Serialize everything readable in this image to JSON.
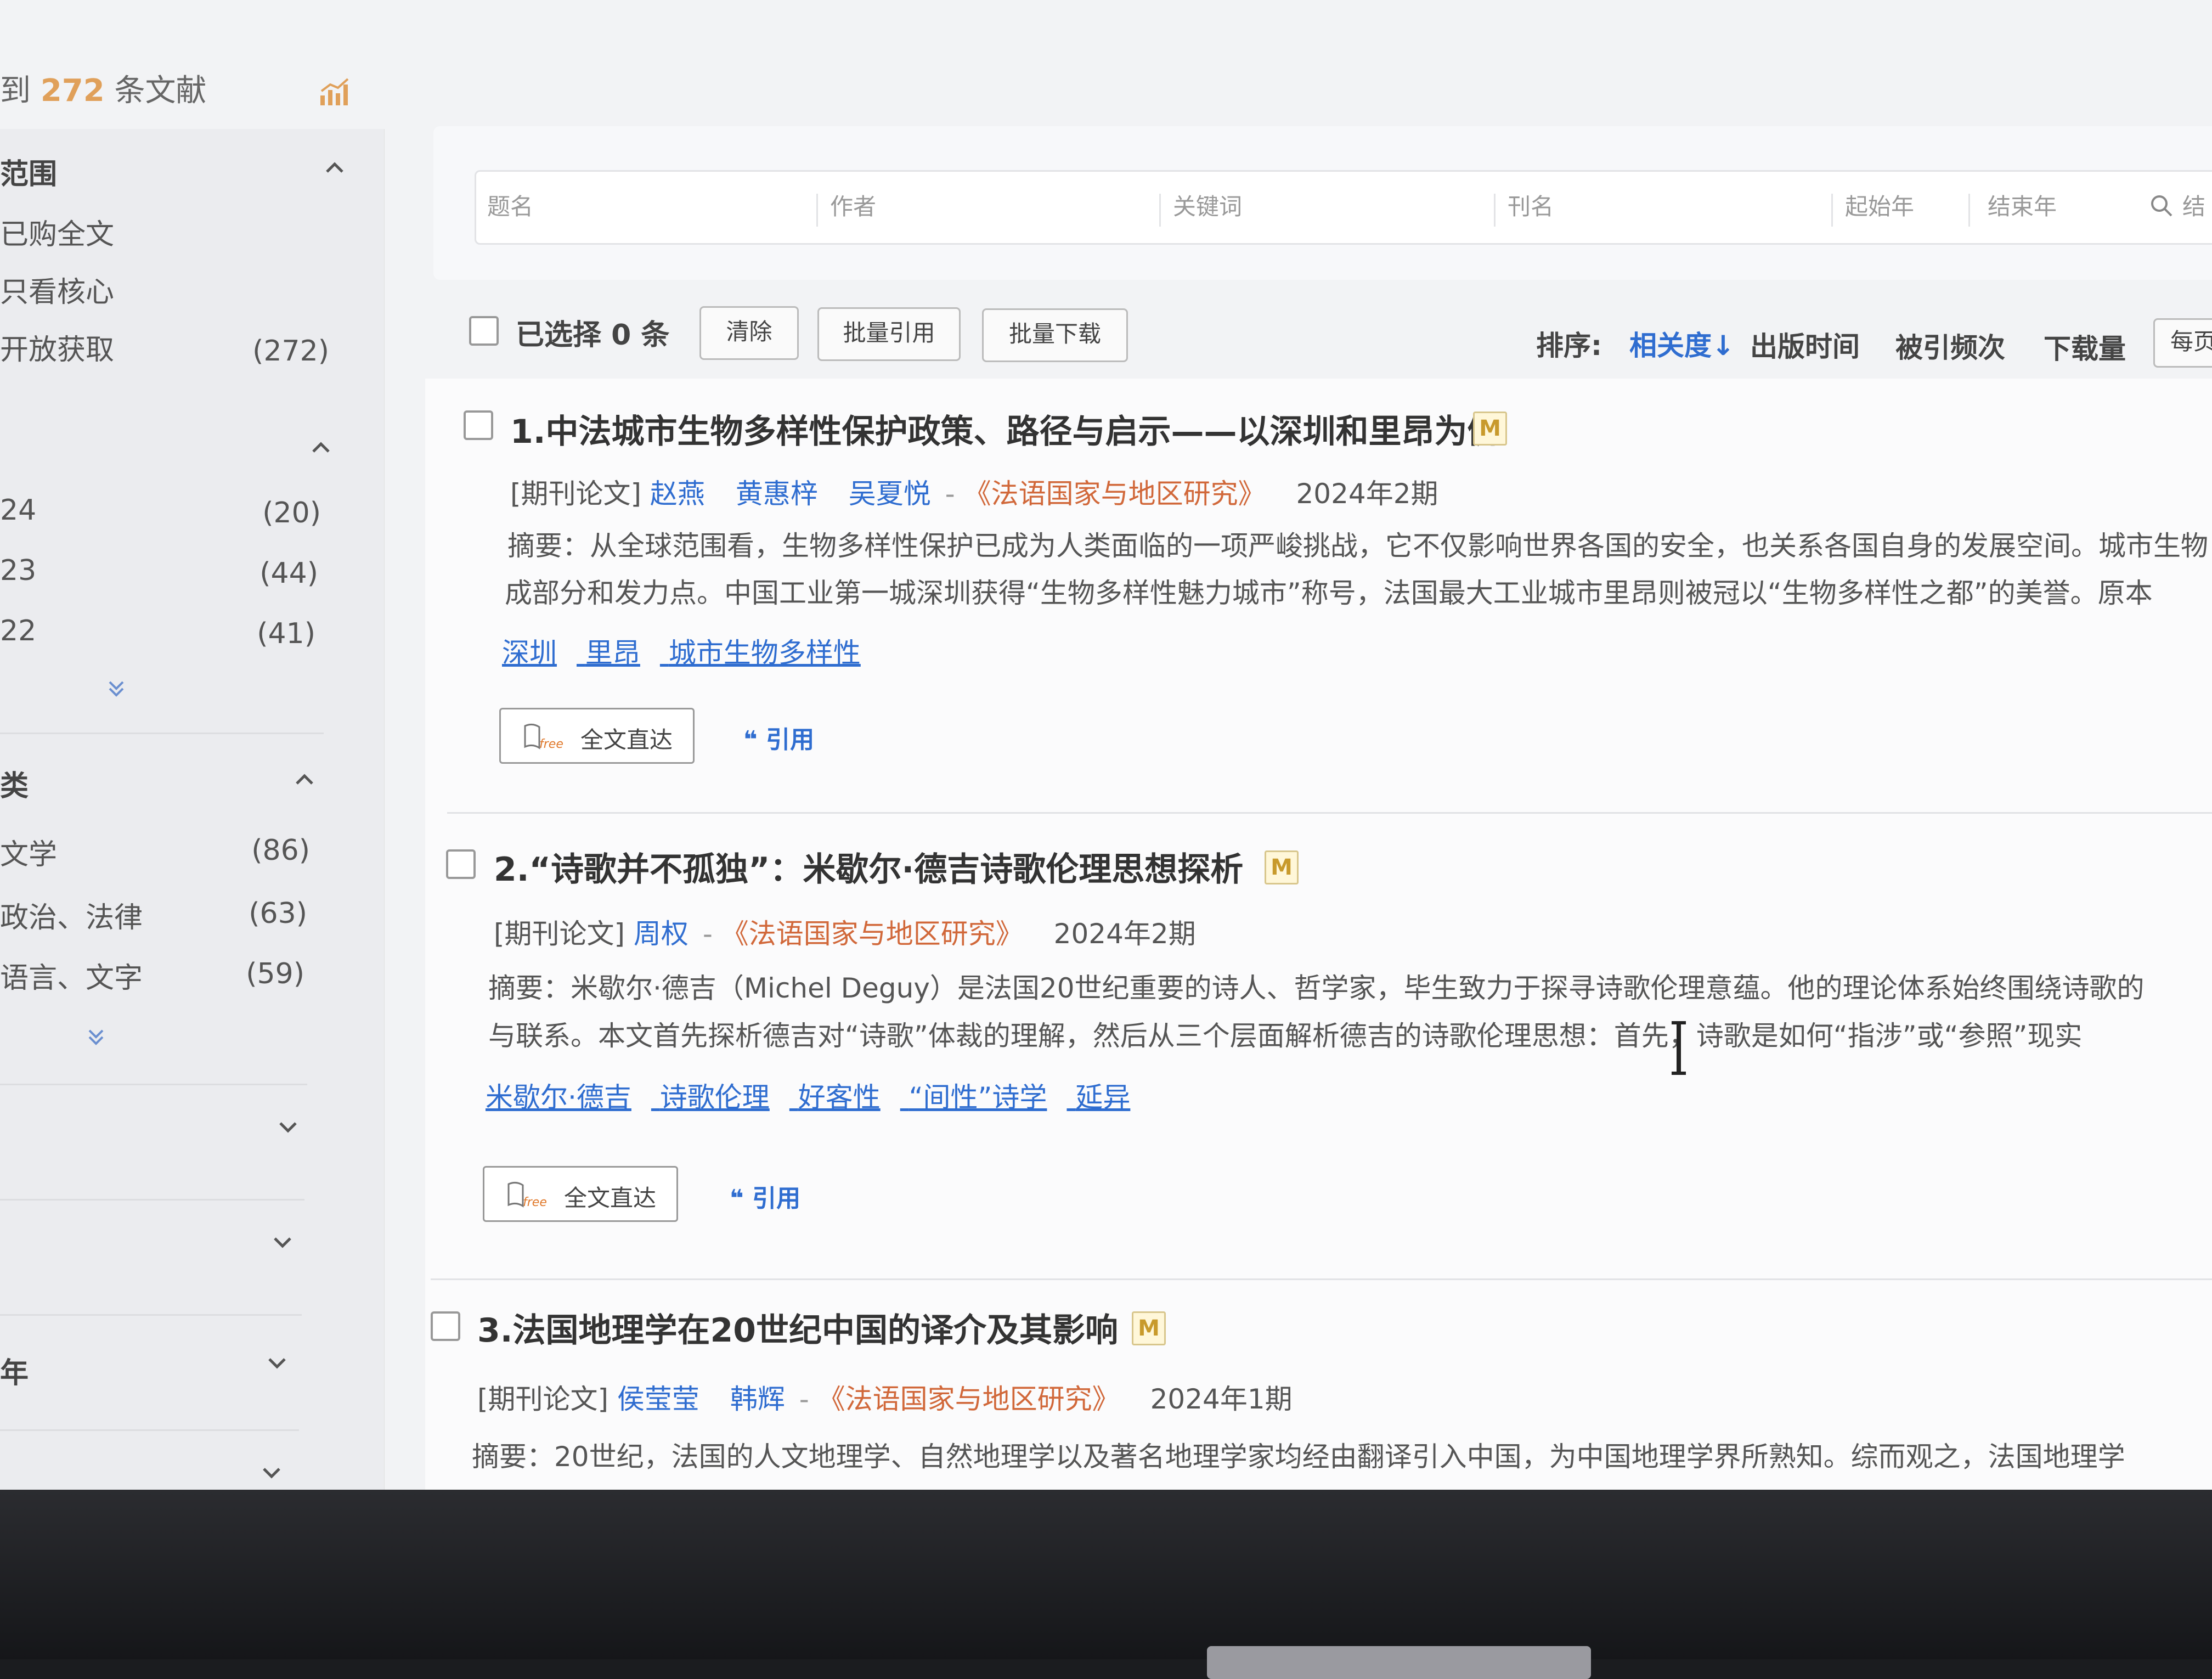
{
  "header": {
    "count_prefix": "到",
    "count": "272",
    "count_suffix": "条文献"
  },
  "sidebar": {
    "range": {
      "title": "范围",
      "items": [
        {
          "label": "已购全文",
          "count": ""
        },
        {
          "label": "只看核心",
          "count": ""
        },
        {
          "label": "开放获取",
          "count": "(272)"
        }
      ]
    },
    "year": {
      "title": "",
      "items": [
        {
          "label": "24",
          "count": "(20)"
        },
        {
          "label": "23",
          "count": "(44)"
        },
        {
          "label": "22",
          "count": "(41)"
        }
      ]
    },
    "subject": {
      "title": "类",
      "items": [
        {
          "label": "文学",
          "count": "(86)"
        },
        {
          "label": "政治、法律",
          "count": "(63)"
        },
        {
          "label": "语言、文字",
          "count": "(59)"
        }
      ]
    },
    "collapsed_section_label": "年"
  },
  "search": {
    "title_placeholder": "题名",
    "author_placeholder": "作者",
    "keyword_placeholder": "关键词",
    "journal_placeholder": "刊名",
    "start_year_placeholder": "起始年",
    "end_year_placeholder": "结束年",
    "search_in_results": "结"
  },
  "toolbar": {
    "selected": "已选择 0 条",
    "clear": "清除",
    "batch_cite": "批量引用",
    "batch_download": "批量下载",
    "sort_label": "排序:",
    "sort_relevance": "相关度↓",
    "sort_date": "出版时间",
    "sort_citations": "被引频次",
    "sort_downloads": "下载量",
    "per_page": "每页"
  },
  "results": [
    {
      "title": "1.中法城市生物多样性保护政策、路径与启示——以深圳和里昂为例",
      "badge": "M",
      "type": "[期刊论文]",
      "authors": [
        "赵燕",
        "黄惠梓",
        "吴夏悦"
      ],
      "journal": "《法语国家与地区研究》",
      "issue": "2024年2期",
      "abstract_line1": "摘要：从全球范围看，生物多样性保护已成为人类面临的一项严峻挑战，它不仅影响世界各国的安全，也关系各国自身的发展空间。城市生物",
      "abstract_line2": "成部分和发力点。中国工业第一城深圳获得“生物多样性魅力城市”称号，法国最大工业城市里昂则被冠以“生物多样性之都”的美誉。原本",
      "keywords": [
        "深圳",
        "里昂",
        "城市生物多样性"
      ],
      "full_text": "全文直达",
      "cite": "引用"
    },
    {
      "title": "2.“诗歌并不孤独”：米歇尔·德吉诗歌伦理思想探析",
      "badge": "M",
      "type": "[期刊论文]",
      "authors": [
        "周权"
      ],
      "journal": "《法语国家与地区研究》",
      "issue": "2024年2期",
      "abstract_line1": "摘要：米歇尔·德吉（Michel Deguy）是法国20世纪重要的诗人、哲学家，毕生致力于探寻诗歌伦理意蕴。他的理论体系始终围绕诗歌的",
      "abstract_line2": "与联系。本文首先探析德吉对“诗歌”体裁的理解，然后从三个层面解析德吉的诗歌伦理思想：首先，诗歌是如何“指涉”或“参照”现实",
      "keywords": [
        "米歇尔·德吉",
        "诗歌伦理",
        "好客性",
        "“间性”诗学",
        "延异"
      ],
      "full_text": "全文直达",
      "cite": "引用"
    },
    {
      "title": "3.法国地理学在20世纪中国的译介及其影响",
      "badge": "M",
      "type": "[期刊论文]",
      "authors": [
        "侯莹莹",
        "韩辉"
      ],
      "journal": "《法语国家与地区研究》",
      "issue": "2024年1期",
      "abstract_line1": "摘要：20世纪，法国的人文地理学、自然地理学以及著名地理学家均经由翻译引入中国，为中国地理学界所熟知。综而观之，法国地理学"
    }
  ]
}
